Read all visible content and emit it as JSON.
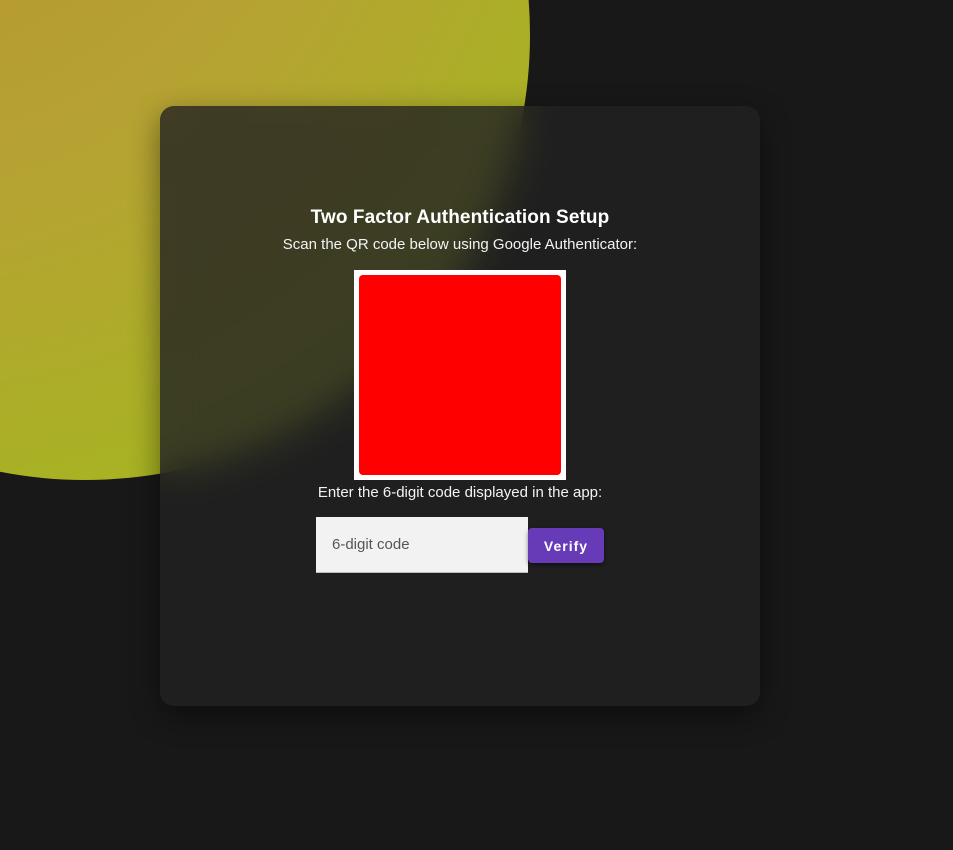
{
  "page": {
    "title": "Two Factor Authentication Setup",
    "subtitle": "Scan the QR code below using Google Authenticator:",
    "prompt": "Enter the 6-digit code displayed in the app:"
  },
  "form": {
    "code_value": "",
    "code_placeholder": "6-digit code",
    "verify_label": "Verify"
  },
  "colors": {
    "background": "#181818",
    "card": "#222222",
    "qr_placeholder": "#ff0000",
    "button": "#673ab7",
    "accent_yellow": "#b5a432"
  },
  "icons": {
    "qr_code": "qr-code-icon"
  }
}
